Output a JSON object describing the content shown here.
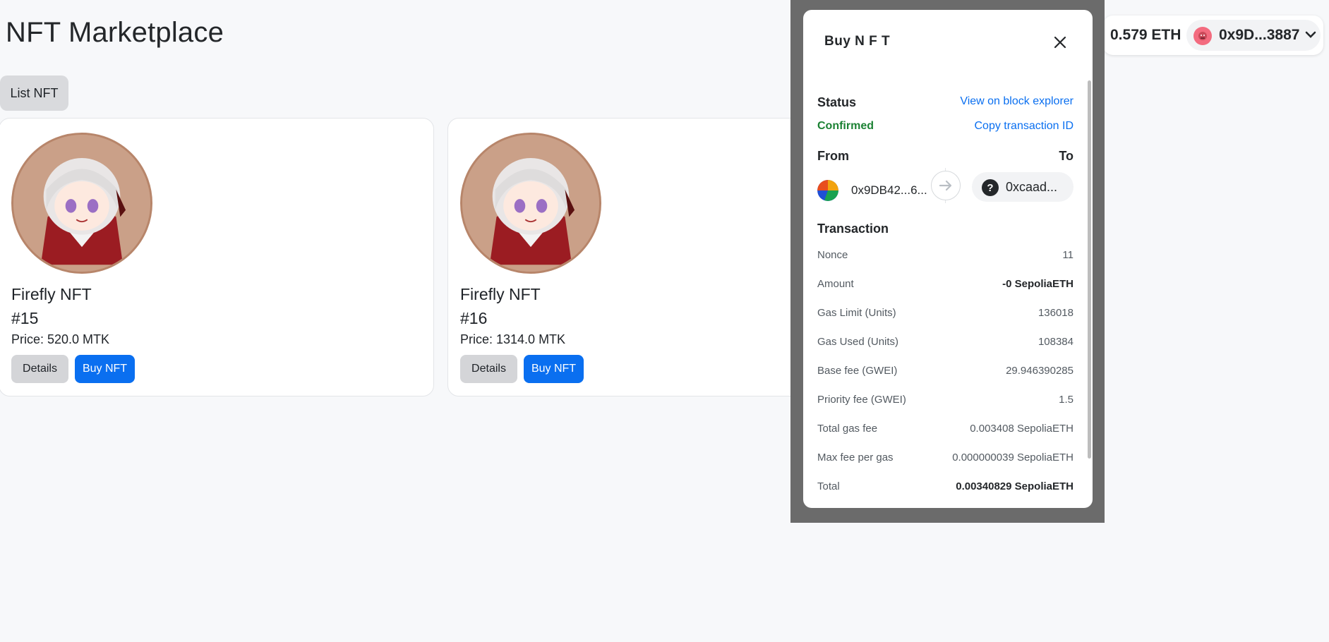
{
  "page": {
    "title": "NFT Marketplace",
    "list_button": "List NFT"
  },
  "cards": [
    {
      "name": "Firefly NFT",
      "token_id": "#15",
      "price": "Price: 520.0 MTK",
      "details_label": "Details",
      "buy_label": "Buy NFT"
    },
    {
      "name": "Firefly NFT",
      "token_id": "#16",
      "price": "Price: 1314.0 MTK",
      "details_label": "Details",
      "buy_label": "Buy NFT"
    }
  ],
  "wallet": {
    "balance": "0.579 ETH",
    "account": "0x9D...3887"
  },
  "modal": {
    "title": "Buy N F T",
    "status_label": "Status",
    "status_value": "Confirmed",
    "explorer_link": "View on block explorer",
    "copy_link": "Copy transaction ID",
    "from_label": "From",
    "to_label": "To",
    "from_address": "0x9DB42...6...",
    "to_address": "0xcaad...",
    "transaction_label": "Transaction",
    "rows": [
      {
        "key": "Nonce",
        "value": "11",
        "bold": false
      },
      {
        "key": "Amount",
        "value": "-0 SepoliaETH",
        "bold": true
      },
      {
        "key": "Gas Limit (Units)",
        "value": "136018",
        "bold": false
      },
      {
        "key": "Gas Used (Units)",
        "value": "108384",
        "bold": false
      },
      {
        "key": "Base fee (GWEI)",
        "value": "29.946390285",
        "bold": false
      },
      {
        "key": "Priority fee (GWEI)",
        "value": "1.5",
        "bold": false
      },
      {
        "key": "Total gas fee",
        "value": "0.003408 SepoliaETH",
        "bold": false
      },
      {
        "key": "Max fee per gas",
        "value": "0.000000039 SepoliaETH",
        "bold": false
      },
      {
        "key": "Total",
        "value": "0.00340829 SepoliaETH",
        "bold": true
      }
    ]
  },
  "colors": {
    "accent": "#0a6ff0",
    "confirmed": "#1c8234",
    "overlay": "#6b6b6b"
  }
}
